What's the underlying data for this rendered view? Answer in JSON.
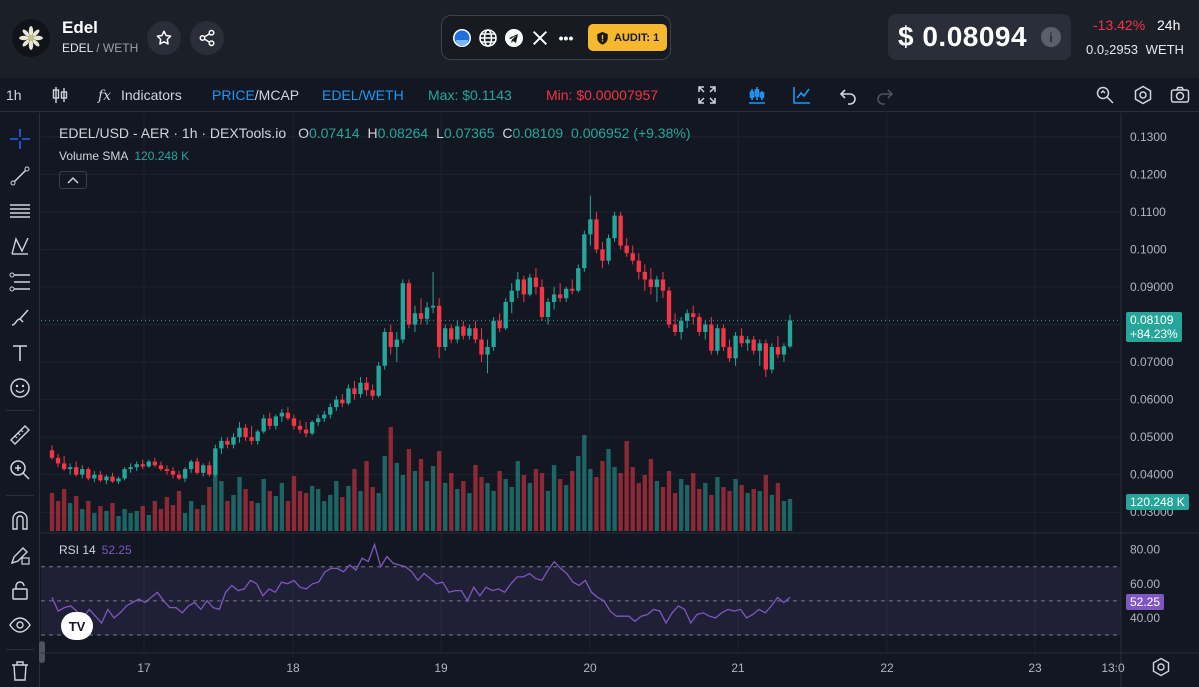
{
  "header": {
    "token_name": "Edel",
    "token_symbol": "EDEL",
    "quote_symbol": "WETH",
    "price_usd": "$ 0.08094",
    "change_24h": "-13.42%",
    "period": "24h",
    "price_weth": "0.0₂2953",
    "price_weth_unit": "WETH",
    "audit_label": "AUDIT: 1",
    "social_more": "•••"
  },
  "toolbar": {
    "interval": "1h",
    "indicators": "Indicators",
    "price_label": "PRICE",
    "mcap_label": "/MCAP",
    "pair": "EDEL/WETH",
    "max": "Max: $0.1143",
    "min": "Min: $0.00007957"
  },
  "legend": {
    "title": "EDEL/USD - AER · 1h · DEXTools.io",
    "o_key": "O",
    "o": "0.07414",
    "h_key": "H",
    "h": "0.08264",
    "l_key": "L",
    "l": "0.07365",
    "c_key": "C",
    "c": "0.08109",
    "change": "0.006952 (+9.38%)",
    "volume_label": "Volume SMA",
    "volume_value": "120.248 K",
    "rsi_label": "RSI 14",
    "rsi_value": "52.25"
  },
  "labels": {
    "last_price": "0.08109",
    "last_change": "+84.23%",
    "volume": "120.248 K",
    "rsi": "52.25",
    "tv_logo": "TV"
  },
  "colors": {
    "up": "#26a69a",
    "down": "#f23645",
    "rsi": "#7e57c2",
    "price_down": "#f23645",
    "max": "#26a69a",
    "min": "#f23645",
    "accent": "#2962ff"
  },
  "chart_data": {
    "type": "candlestick",
    "price_axis": {
      "min": 0.025,
      "max": 0.135,
      "ticks": [
        "0.1300",
        "0.1200",
        "0.1100",
        "0.1000",
        "0.09000",
        "0.08000",
        "0.07000",
        "0.06000",
        "0.05000",
        "0.04000",
        "0.03000"
      ]
    },
    "rsi_axis": {
      "ticks": [
        "80.00",
        "60.00",
        "40.00"
      ],
      "upper_band": 70,
      "lower_band": 30,
      "mid": 50
    },
    "x_ticks": [
      "17",
      "18",
      "19",
      "20",
      "21",
      "22",
      "23",
      "13:0"
    ],
    "candles": [
      {
        "o": 0.0465,
        "h": 0.0478,
        "l": 0.044,
        "c": 0.0445
      },
      {
        "o": 0.0445,
        "h": 0.0455,
        "l": 0.042,
        "c": 0.043
      },
      {
        "o": 0.043,
        "h": 0.045,
        "l": 0.041,
        "c": 0.0415
      },
      {
        "o": 0.0415,
        "h": 0.043,
        "l": 0.04,
        "c": 0.042
      },
      {
        "o": 0.042,
        "h": 0.0435,
        "l": 0.0395,
        "c": 0.04
      },
      {
        "o": 0.04,
        "h": 0.0425,
        "l": 0.039,
        "c": 0.0415
      },
      {
        "o": 0.0415,
        "h": 0.042,
        "l": 0.0385,
        "c": 0.039
      },
      {
        "o": 0.039,
        "h": 0.041,
        "l": 0.038,
        "c": 0.04
      },
      {
        "o": 0.04,
        "h": 0.041,
        "l": 0.038,
        "c": 0.0385
      },
      {
        "o": 0.0385,
        "h": 0.04,
        "l": 0.0375,
        "c": 0.0395
      },
      {
        "o": 0.0395,
        "h": 0.0405,
        "l": 0.0378,
        "c": 0.0382
      },
      {
        "o": 0.0382,
        "h": 0.0395,
        "l": 0.0375,
        "c": 0.039
      },
      {
        "o": 0.039,
        "h": 0.042,
        "l": 0.0385,
        "c": 0.0415
      },
      {
        "o": 0.0415,
        "h": 0.043,
        "l": 0.0405,
        "c": 0.042
      },
      {
        "o": 0.042,
        "h": 0.0435,
        "l": 0.041,
        "c": 0.0428
      },
      {
        "o": 0.0428,
        "h": 0.044,
        "l": 0.0415,
        "c": 0.0422
      },
      {
        "o": 0.0422,
        "h": 0.044,
        "l": 0.0418,
        "c": 0.0435
      },
      {
        "o": 0.0435,
        "h": 0.0445,
        "l": 0.042,
        "c": 0.0425
      },
      {
        "o": 0.0425,
        "h": 0.0435,
        "l": 0.041,
        "c": 0.0415
      },
      {
        "o": 0.0415,
        "h": 0.0425,
        "l": 0.04,
        "c": 0.041
      },
      {
        "o": 0.041,
        "h": 0.042,
        "l": 0.039,
        "c": 0.04
      },
      {
        "o": 0.04,
        "h": 0.041,
        "l": 0.0385,
        "c": 0.039
      },
      {
        "o": 0.039,
        "h": 0.042,
        "l": 0.038,
        "c": 0.0415
      },
      {
        "o": 0.0415,
        "h": 0.044,
        "l": 0.0405,
        "c": 0.0435
      },
      {
        "o": 0.0435,
        "h": 0.0445,
        "l": 0.04,
        "c": 0.0405
      },
      {
        "o": 0.0405,
        "h": 0.043,
        "l": 0.0395,
        "c": 0.0425
      },
      {
        "o": 0.0425,
        "h": 0.0435,
        "l": 0.0395,
        "c": 0.04
      },
      {
        "o": 0.04,
        "h": 0.048,
        "l": 0.0395,
        "c": 0.047
      },
      {
        "o": 0.047,
        "h": 0.05,
        "l": 0.0455,
        "c": 0.049
      },
      {
        "o": 0.049,
        "h": 0.05,
        "l": 0.047,
        "c": 0.048
      },
      {
        "o": 0.048,
        "h": 0.051,
        "l": 0.047,
        "c": 0.05
      },
      {
        "o": 0.05,
        "h": 0.054,
        "l": 0.0485,
        "c": 0.0525
      },
      {
        "o": 0.0525,
        "h": 0.0535,
        "l": 0.049,
        "c": 0.05
      },
      {
        "o": 0.05,
        "h": 0.053,
        "l": 0.048,
        "c": 0.049
      },
      {
        "o": 0.049,
        "h": 0.052,
        "l": 0.048,
        "c": 0.0515
      },
      {
        "o": 0.0515,
        "h": 0.056,
        "l": 0.051,
        "c": 0.055
      },
      {
        "o": 0.055,
        "h": 0.0565,
        "l": 0.052,
        "c": 0.053
      },
      {
        "o": 0.053,
        "h": 0.056,
        "l": 0.052,
        "c": 0.0555
      },
      {
        "o": 0.0555,
        "h": 0.0575,
        "l": 0.054,
        "c": 0.0565
      },
      {
        "o": 0.0565,
        "h": 0.058,
        "l": 0.0545,
        "c": 0.055
      },
      {
        "o": 0.055,
        "h": 0.056,
        "l": 0.052,
        "c": 0.053
      },
      {
        "o": 0.053,
        "h": 0.0545,
        "l": 0.051,
        "c": 0.052
      },
      {
        "o": 0.052,
        "h": 0.054,
        "l": 0.05,
        "c": 0.051
      },
      {
        "o": 0.051,
        "h": 0.0545,
        "l": 0.0505,
        "c": 0.054
      },
      {
        "o": 0.054,
        "h": 0.056,
        "l": 0.053,
        "c": 0.055
      },
      {
        "o": 0.055,
        "h": 0.057,
        "l": 0.054,
        "c": 0.056
      },
      {
        "o": 0.056,
        "h": 0.059,
        "l": 0.055,
        "c": 0.058
      },
      {
        "o": 0.058,
        "h": 0.061,
        "l": 0.057,
        "c": 0.06
      },
      {
        "o": 0.06,
        "h": 0.0615,
        "l": 0.058,
        "c": 0.059
      },
      {
        "o": 0.059,
        "h": 0.064,
        "l": 0.0585,
        "c": 0.063
      },
      {
        "o": 0.063,
        "h": 0.065,
        "l": 0.06,
        "c": 0.0615
      },
      {
        "o": 0.0615,
        "h": 0.066,
        "l": 0.0605,
        "c": 0.0645
      },
      {
        "o": 0.0645,
        "h": 0.066,
        "l": 0.061,
        "c": 0.0625
      },
      {
        "o": 0.0625,
        "h": 0.064,
        "l": 0.06,
        "c": 0.061
      },
      {
        "o": 0.061,
        "h": 0.07,
        "l": 0.0605,
        "c": 0.069
      },
      {
        "o": 0.069,
        "h": 0.079,
        "l": 0.068,
        "c": 0.078
      },
      {
        "o": 0.078,
        "h": 0.08,
        "l": 0.072,
        "c": 0.074
      },
      {
        "o": 0.074,
        "h": 0.078,
        "l": 0.07,
        "c": 0.076
      },
      {
        "o": 0.076,
        "h": 0.092,
        "l": 0.075,
        "c": 0.091
      },
      {
        "o": 0.091,
        "h": 0.092,
        "l": 0.079,
        "c": 0.08
      },
      {
        "o": 0.08,
        "h": 0.085,
        "l": 0.078,
        "c": 0.083
      },
      {
        "o": 0.083,
        "h": 0.087,
        "l": 0.08,
        "c": 0.0815
      },
      {
        "o": 0.0815,
        "h": 0.086,
        "l": 0.08,
        "c": 0.0845
      },
      {
        "o": 0.0845,
        "h": 0.094,
        "l": 0.083,
        "c": 0.085
      },
      {
        "o": 0.085,
        "h": 0.087,
        "l": 0.071,
        "c": 0.074
      },
      {
        "o": 0.074,
        "h": 0.08,
        "l": 0.073,
        "c": 0.079
      },
      {
        "o": 0.079,
        "h": 0.08,
        "l": 0.075,
        "c": 0.076
      },
      {
        "o": 0.076,
        "h": 0.081,
        "l": 0.075,
        "c": 0.0795
      },
      {
        "o": 0.0795,
        "h": 0.081,
        "l": 0.076,
        "c": 0.077
      },
      {
        "o": 0.077,
        "h": 0.08,
        "l": 0.076,
        "c": 0.079
      },
      {
        "o": 0.079,
        "h": 0.081,
        "l": 0.075,
        "c": 0.076
      },
      {
        "o": 0.076,
        "h": 0.079,
        "l": 0.07,
        "c": 0.072
      },
      {
        "o": 0.072,
        "h": 0.076,
        "l": 0.067,
        "c": 0.074
      },
      {
        "o": 0.074,
        "h": 0.082,
        "l": 0.073,
        "c": 0.081
      },
      {
        "o": 0.081,
        "h": 0.083,
        "l": 0.078,
        "c": 0.079
      },
      {
        "o": 0.079,
        "h": 0.087,
        "l": 0.0785,
        "c": 0.086
      },
      {
        "o": 0.086,
        "h": 0.091,
        "l": 0.083,
        "c": 0.089
      },
      {
        "o": 0.089,
        "h": 0.094,
        "l": 0.087,
        "c": 0.092
      },
      {
        "o": 0.092,
        "h": 0.093,
        "l": 0.086,
        "c": 0.088
      },
      {
        "o": 0.088,
        "h": 0.0935,
        "l": 0.0875,
        "c": 0.0925
      },
      {
        "o": 0.0925,
        "h": 0.095,
        "l": 0.088,
        "c": 0.09
      },
      {
        "o": 0.09,
        "h": 0.092,
        "l": 0.081,
        "c": 0.082
      },
      {
        "o": 0.082,
        "h": 0.087,
        "l": 0.08,
        "c": 0.086
      },
      {
        "o": 0.086,
        "h": 0.09,
        "l": 0.084,
        "c": 0.088
      },
      {
        "o": 0.088,
        "h": 0.091,
        "l": 0.086,
        "c": 0.087
      },
      {
        "o": 0.087,
        "h": 0.09,
        "l": 0.086,
        "c": 0.0895
      },
      {
        "o": 0.0895,
        "h": 0.092,
        "l": 0.088,
        "c": 0.089
      },
      {
        "o": 0.089,
        "h": 0.096,
        "l": 0.0885,
        "c": 0.095
      },
      {
        "o": 0.095,
        "h": 0.105,
        "l": 0.094,
        "c": 0.104
      },
      {
        "o": 0.104,
        "h": 0.1143,
        "l": 0.101,
        "c": 0.108
      },
      {
        "o": 0.108,
        "h": 0.11,
        "l": 0.099,
        "c": 0.1
      },
      {
        "o": 0.1,
        "h": 0.102,
        "l": 0.095,
        "c": 0.097
      },
      {
        "o": 0.097,
        "h": 0.104,
        "l": 0.096,
        "c": 0.103
      },
      {
        "o": 0.103,
        "h": 0.11,
        "l": 0.102,
        "c": 0.109
      },
      {
        "o": 0.109,
        "h": 0.11,
        "l": 0.1,
        "c": 0.101
      },
      {
        "o": 0.101,
        "h": 0.103,
        "l": 0.098,
        "c": 0.099
      },
      {
        "o": 0.099,
        "h": 0.101,
        "l": 0.096,
        "c": 0.097
      },
      {
        "o": 0.097,
        "h": 0.099,
        "l": 0.092,
        "c": 0.094
      },
      {
        "o": 0.094,
        "h": 0.096,
        "l": 0.089,
        "c": 0.092
      },
      {
        "o": 0.092,
        "h": 0.095,
        "l": 0.088,
        "c": 0.09
      },
      {
        "o": 0.09,
        "h": 0.093,
        "l": 0.086,
        "c": 0.092
      },
      {
        "o": 0.092,
        "h": 0.094,
        "l": 0.087,
        "c": 0.089
      },
      {
        "o": 0.089,
        "h": 0.09,
        "l": 0.079,
        "c": 0.08
      },
      {
        "o": 0.08,
        "h": 0.083,
        "l": 0.077,
        "c": 0.078
      },
      {
        "o": 0.078,
        "h": 0.082,
        "l": 0.076,
        "c": 0.081
      },
      {
        "o": 0.081,
        "h": 0.084,
        "l": 0.079,
        "c": 0.083
      },
      {
        "o": 0.083,
        "h": 0.085,
        "l": 0.08,
        "c": 0.082
      },
      {
        "o": 0.082,
        "h": 0.083,
        "l": 0.077,
        "c": 0.078
      },
      {
        "o": 0.078,
        "h": 0.081,
        "l": 0.076,
        "c": 0.08
      },
      {
        "o": 0.08,
        "h": 0.082,
        "l": 0.072,
        "c": 0.073
      },
      {
        "o": 0.073,
        "h": 0.08,
        "l": 0.072,
        "c": 0.079
      },
      {
        "o": 0.079,
        "h": 0.08,
        "l": 0.073,
        "c": 0.074
      },
      {
        "o": 0.074,
        "h": 0.076,
        "l": 0.07,
        "c": 0.071
      },
      {
        "o": 0.071,
        "h": 0.078,
        "l": 0.069,
        "c": 0.077
      },
      {
        "o": 0.077,
        "h": 0.079,
        "l": 0.074,
        "c": 0.075
      },
      {
        "o": 0.075,
        "h": 0.077,
        "l": 0.073,
        "c": 0.076
      },
      {
        "o": 0.076,
        "h": 0.077,
        "l": 0.072,
        "c": 0.073
      },
      {
        "o": 0.073,
        "h": 0.076,
        "l": 0.069,
        "c": 0.075
      },
      {
        "o": 0.075,
        "h": 0.076,
        "l": 0.066,
        "c": 0.068
      },
      {
        "o": 0.068,
        "h": 0.075,
        "l": 0.067,
        "c": 0.074
      },
      {
        "o": 0.074,
        "h": 0.077,
        "l": 0.071,
        "c": 0.072
      },
      {
        "o": 0.072,
        "h": 0.075,
        "l": 0.07,
        "c": 0.0742
      },
      {
        "o": 0.07414,
        "h": 0.08264,
        "l": 0.07365,
        "c": 0.08109
      }
    ],
    "volume": [
      38,
      30,
      42,
      28,
      35,
      22,
      30,
      18,
      25,
      20,
      28,
      15,
      22,
      18,
      20,
      25,
      16,
      30,
      22,
      34,
      26,
      40,
      18,
      30,
      22,
      26,
      44,
      58,
      50,
      30,
      36,
      54,
      42,
      30,
      28,
      52,
      40,
      35,
      48,
      30,
      55,
      40,
      38,
      45,
      42,
      30,
      36,
      50,
      34,
      45,
      62,
      40,
      70,
      44,
      38,
      75,
      104,
      68,
      56,
      82,
      60,
      72,
      50,
      65,
      80,
      48,
      58,
      42,
      50,
      38,
      66,
      54,
      48,
      40,
      60,
      52,
      44,
      70,
      56,
      48,
      62,
      58,
      40,
      66,
      52,
      46,
      60,
      75,
      96,
      62,
      54,
      70,
      82,
      64,
      58,
      90,
      64,
      48,
      56,
      72,
      50,
      44,
      60,
      38,
      52,
      46,
      58,
      42,
      48,
      36,
      54,
      44,
      40,
      52,
      46,
      38,
      42,
      40,
      56,
      36,
      48,
      30,
      32,
      30,
      32
    ],
    "rsi": [
      52,
      44,
      46,
      47,
      44,
      40,
      45,
      41,
      37,
      45,
      40,
      43,
      47,
      49,
      51,
      49,
      52,
      55,
      50,
      46,
      46,
      43,
      47,
      49,
      45,
      50,
      46,
      45,
      55,
      59,
      56,
      57,
      62,
      60,
      53,
      57,
      55,
      61,
      60,
      62,
      58,
      57,
      60,
      61,
      67,
      69,
      69,
      67,
      71,
      68,
      75,
      73,
      83,
      70,
      76,
      72,
      71,
      70,
      67,
      62,
      66,
      63,
      60,
      61,
      55,
      56,
      56,
      50,
      58,
      53,
      58,
      56,
      57,
      55,
      60,
      64,
      64,
      66,
      63,
      62,
      68,
      73,
      69,
      66,
      61,
      59,
      62,
      55,
      52,
      50,
      44,
      41,
      41,
      41,
      38,
      41,
      42,
      45,
      44,
      37,
      43,
      47,
      45,
      37,
      42,
      43,
      41,
      40,
      43,
      45,
      44,
      45,
      40,
      42,
      45,
      43,
      47,
      52,
      49,
      52
    ]
  }
}
